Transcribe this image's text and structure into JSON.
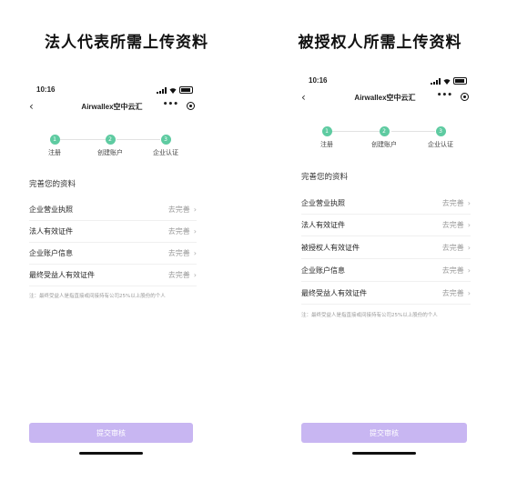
{
  "panels": [
    {
      "heading": "法人代表所需上传资料",
      "status_time": "10:16",
      "nav_title": "Airwallex空中云汇",
      "more": "•••",
      "steps": [
        "注册",
        "创建账户",
        "企业认证"
      ],
      "section_title": "完善您的资料",
      "rows": [
        {
          "label": "企业营业执照",
          "action": "去完善"
        },
        {
          "label": "法人有效证件",
          "action": "去完善"
        },
        {
          "label": "企业账户信息",
          "action": "去完善"
        },
        {
          "label": "最终受益人有效证件",
          "action": "去完善"
        }
      ],
      "note": "注：最终受益人是指直接或间接持有公司25%以上股份的个人",
      "submit": "提交审核"
    },
    {
      "heading": "被授权人所需上传资料",
      "status_time": "10:16",
      "nav_title": "Airwallex空中云汇",
      "more": "•••",
      "steps": [
        "注册",
        "创建账户",
        "企业认证"
      ],
      "section_title": "完善您的资料",
      "rows": [
        {
          "label": "企业营业执照",
          "action": "去完善"
        },
        {
          "label": "法人有效证件",
          "action": "去完善"
        },
        {
          "label": "被授权人有效证件",
          "action": "去完善"
        },
        {
          "label": "企业账户信息",
          "action": "去完善"
        },
        {
          "label": "最终受益人有效证件",
          "action": "去完善"
        }
      ],
      "note": "注：最终受益人是指直接或间接持有公司25%以上股份的个人",
      "submit": "提交审核"
    }
  ],
  "colors": {
    "step": "#5ecba1",
    "submit": "#c8b6f2"
  },
  "icons": {
    "back": "chevron-left-icon",
    "more": "more-dots-icon",
    "close": "miniprogram-close-icon",
    "chevron": "chevron-right-icon"
  }
}
